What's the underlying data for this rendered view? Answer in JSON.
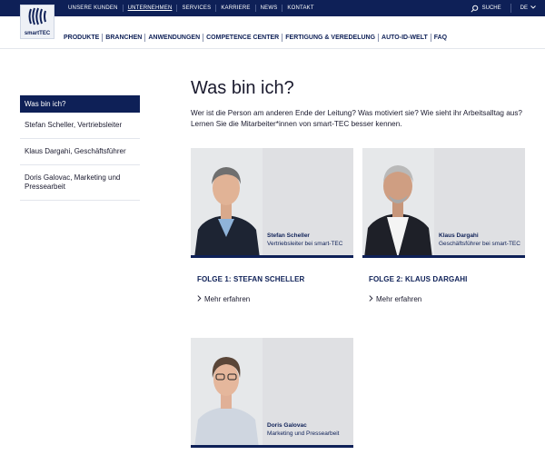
{
  "topnav": {
    "items": [
      {
        "label": "UNSERE KUNDEN"
      },
      {
        "label": "UNTERNEHMEN"
      },
      {
        "label": "SERVICES"
      },
      {
        "label": "KARRIERE"
      },
      {
        "label": "NEWS"
      },
      {
        "label": "KONTAKT"
      }
    ],
    "search_label": "SUCHE",
    "lang_label": "DE"
  },
  "logo": {
    "text": "smartTEC"
  },
  "mainnav": {
    "items": [
      {
        "label": "PRODUKTE"
      },
      {
        "label": "BRANCHEN"
      },
      {
        "label": "ANWENDUNGEN"
      },
      {
        "label": "COMPETENCE CENTER"
      },
      {
        "label": "FERTIGUNG & VEREDELUNG"
      },
      {
        "label": "AUTO-ID-WELT"
      },
      {
        "label": "FAQ"
      }
    ]
  },
  "sidebar": {
    "items": [
      {
        "label": "Was bin ich?"
      },
      {
        "label": "Stefan Scheller, Vertriebsleiter"
      },
      {
        "label": "Klaus Dargahi, Geschäftsführer"
      },
      {
        "label": "Doris Galovac, Marketing und Pressearbeit"
      }
    ]
  },
  "main": {
    "title": "Was bin ich?",
    "intro": "Wer ist die Person am anderen Ende der Leitung? Was motiviert sie? Wie sieht ihr Arbeitsalltag aus? Lernen Sie die Mitarbeiter*innen von smart-TEC besser kennen.",
    "cards": [
      {
        "name": "Stefan Scheller",
        "role": "Vertriebsleiter bei smart-TEC",
        "folge": "FOLGE 1: STEFAN SCHELLER",
        "more": "Mehr erfahren"
      },
      {
        "name": "Klaus Dargahi",
        "role": "Geschäftsführer bei smart-TEC",
        "folge": "FOLGE 2: KLAUS DARGAHI",
        "more": "Mehr erfahren"
      },
      {
        "name": "Doris Galovac",
        "role": "Marketing und Pressearbeit"
      }
    ]
  },
  "colors": {
    "brand_navy": "#0e2057",
    "card_grey": "#dfe0e3"
  }
}
